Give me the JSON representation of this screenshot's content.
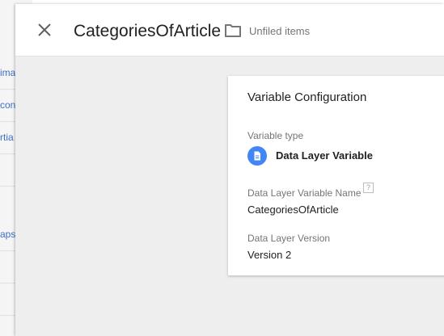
{
  "background": {
    "rows": [
      "ima",
      "con",
      "rtia",
      "",
      "aps",
      ""
    ]
  },
  "header": {
    "close_icon": "close-icon",
    "title": "CategoriesOfArticle",
    "folder_icon": "folder-icon",
    "folder_label": "Unfiled items"
  },
  "card": {
    "title": "Variable Configuration",
    "variable_type_label": "Variable type",
    "variable_type_icon": "document-icon",
    "variable_type_value": "Data Layer Variable",
    "name_label": "Data Layer Variable Name",
    "help_icon_text": "?",
    "name_value": "CategoriesOfArticle",
    "version_label": "Data Layer Version",
    "version_value": "Version 2"
  },
  "colors": {
    "accent": "#4285f4",
    "link": "#3f6fc7"
  }
}
